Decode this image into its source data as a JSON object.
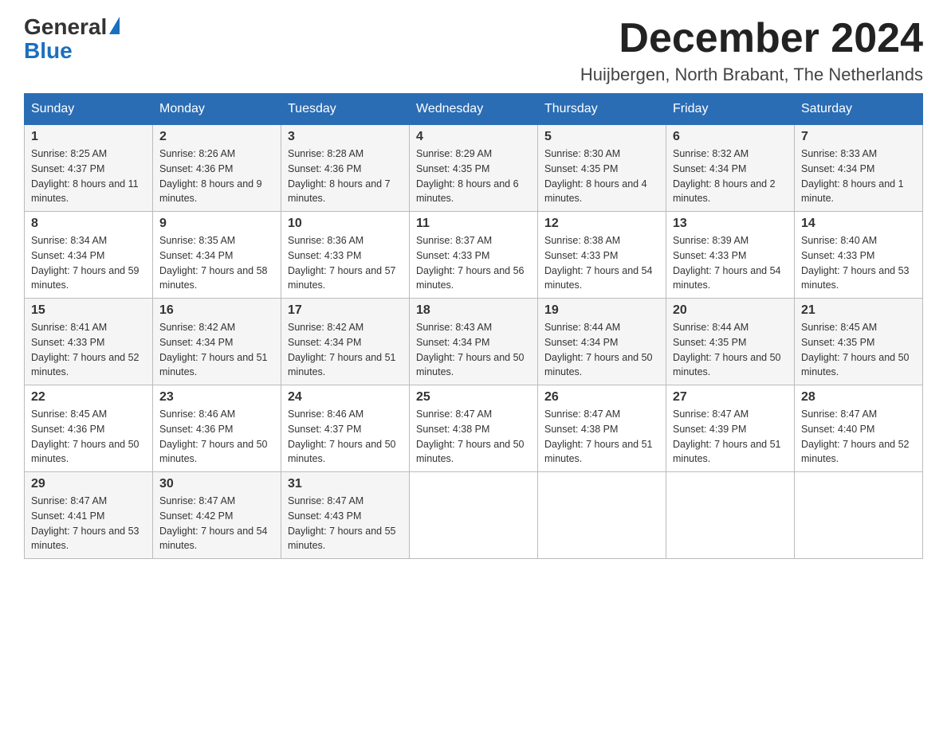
{
  "logo": {
    "line1": "General",
    "line2": "Blue"
  },
  "title": "December 2024",
  "location": "Huijbergen, North Brabant, The Netherlands",
  "weekdays": [
    "Sunday",
    "Monday",
    "Tuesday",
    "Wednesday",
    "Thursday",
    "Friday",
    "Saturday"
  ],
  "weeks": [
    [
      {
        "day": "1",
        "sunrise": "8:25 AM",
        "sunset": "4:37 PM",
        "daylight": "8 hours and 11 minutes."
      },
      {
        "day": "2",
        "sunrise": "8:26 AM",
        "sunset": "4:36 PM",
        "daylight": "8 hours and 9 minutes."
      },
      {
        "day": "3",
        "sunrise": "8:28 AM",
        "sunset": "4:36 PM",
        "daylight": "8 hours and 7 minutes."
      },
      {
        "day": "4",
        "sunrise": "8:29 AM",
        "sunset": "4:35 PM",
        "daylight": "8 hours and 6 minutes."
      },
      {
        "day": "5",
        "sunrise": "8:30 AM",
        "sunset": "4:35 PM",
        "daylight": "8 hours and 4 minutes."
      },
      {
        "day": "6",
        "sunrise": "8:32 AM",
        "sunset": "4:34 PM",
        "daylight": "8 hours and 2 minutes."
      },
      {
        "day": "7",
        "sunrise": "8:33 AM",
        "sunset": "4:34 PM",
        "daylight": "8 hours and 1 minute."
      }
    ],
    [
      {
        "day": "8",
        "sunrise": "8:34 AM",
        "sunset": "4:34 PM",
        "daylight": "7 hours and 59 minutes."
      },
      {
        "day": "9",
        "sunrise": "8:35 AM",
        "sunset": "4:34 PM",
        "daylight": "7 hours and 58 minutes."
      },
      {
        "day": "10",
        "sunrise": "8:36 AM",
        "sunset": "4:33 PM",
        "daylight": "7 hours and 57 minutes."
      },
      {
        "day": "11",
        "sunrise": "8:37 AM",
        "sunset": "4:33 PM",
        "daylight": "7 hours and 56 minutes."
      },
      {
        "day": "12",
        "sunrise": "8:38 AM",
        "sunset": "4:33 PM",
        "daylight": "7 hours and 54 minutes."
      },
      {
        "day": "13",
        "sunrise": "8:39 AM",
        "sunset": "4:33 PM",
        "daylight": "7 hours and 54 minutes."
      },
      {
        "day": "14",
        "sunrise": "8:40 AM",
        "sunset": "4:33 PM",
        "daylight": "7 hours and 53 minutes."
      }
    ],
    [
      {
        "day": "15",
        "sunrise": "8:41 AM",
        "sunset": "4:33 PM",
        "daylight": "7 hours and 52 minutes."
      },
      {
        "day": "16",
        "sunrise": "8:42 AM",
        "sunset": "4:34 PM",
        "daylight": "7 hours and 51 minutes."
      },
      {
        "day": "17",
        "sunrise": "8:42 AM",
        "sunset": "4:34 PM",
        "daylight": "7 hours and 51 minutes."
      },
      {
        "day": "18",
        "sunrise": "8:43 AM",
        "sunset": "4:34 PM",
        "daylight": "7 hours and 50 minutes."
      },
      {
        "day": "19",
        "sunrise": "8:44 AM",
        "sunset": "4:34 PM",
        "daylight": "7 hours and 50 minutes."
      },
      {
        "day": "20",
        "sunrise": "8:44 AM",
        "sunset": "4:35 PM",
        "daylight": "7 hours and 50 minutes."
      },
      {
        "day": "21",
        "sunrise": "8:45 AM",
        "sunset": "4:35 PM",
        "daylight": "7 hours and 50 minutes."
      }
    ],
    [
      {
        "day": "22",
        "sunrise": "8:45 AM",
        "sunset": "4:36 PM",
        "daylight": "7 hours and 50 minutes."
      },
      {
        "day": "23",
        "sunrise": "8:46 AM",
        "sunset": "4:36 PM",
        "daylight": "7 hours and 50 minutes."
      },
      {
        "day": "24",
        "sunrise": "8:46 AM",
        "sunset": "4:37 PM",
        "daylight": "7 hours and 50 minutes."
      },
      {
        "day": "25",
        "sunrise": "8:47 AM",
        "sunset": "4:38 PM",
        "daylight": "7 hours and 50 minutes."
      },
      {
        "day": "26",
        "sunrise": "8:47 AM",
        "sunset": "4:38 PM",
        "daylight": "7 hours and 51 minutes."
      },
      {
        "day": "27",
        "sunrise": "8:47 AM",
        "sunset": "4:39 PM",
        "daylight": "7 hours and 51 minutes."
      },
      {
        "day": "28",
        "sunrise": "8:47 AM",
        "sunset": "4:40 PM",
        "daylight": "7 hours and 52 minutes."
      }
    ],
    [
      {
        "day": "29",
        "sunrise": "8:47 AM",
        "sunset": "4:41 PM",
        "daylight": "7 hours and 53 minutes."
      },
      {
        "day": "30",
        "sunrise": "8:47 AM",
        "sunset": "4:42 PM",
        "daylight": "7 hours and 54 minutes."
      },
      {
        "day": "31",
        "sunrise": "8:47 AM",
        "sunset": "4:43 PM",
        "daylight": "7 hours and 55 minutes."
      },
      null,
      null,
      null,
      null
    ]
  ]
}
